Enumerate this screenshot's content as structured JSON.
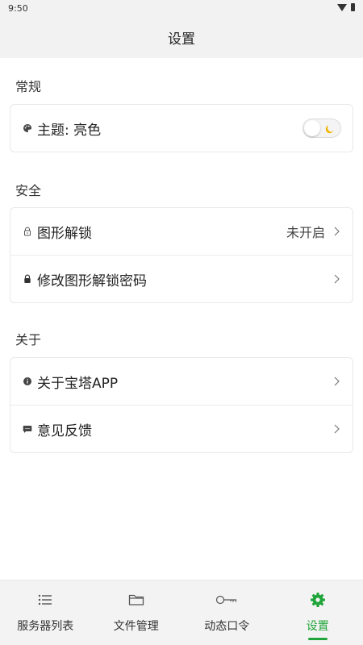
{
  "status_bar": {
    "time": "9:50"
  },
  "app_bar": {
    "title": "设置"
  },
  "sections": {
    "general": {
      "title": "常规",
      "theme": {
        "label": "主题: 亮色",
        "icon": "palette-icon",
        "toggle_on": false,
        "toggle_icon": "moon-icon"
      }
    },
    "security": {
      "title": "安全",
      "pattern_lock": {
        "label": "图形解锁",
        "value": "未开启",
        "icon": "lock-outline-icon"
      },
      "change_pattern": {
        "label": "修改图形解锁密码",
        "icon": "lock-filled-icon"
      }
    },
    "about": {
      "title": "关于",
      "about_app": {
        "label": "关于宝塔APP",
        "icon": "info-icon"
      },
      "feedback": {
        "label": "意见反馈",
        "icon": "chat-icon"
      }
    }
  },
  "tabs": [
    {
      "label": "服务器列表",
      "icon": "list-icon",
      "active": false
    },
    {
      "label": "文件管理",
      "icon": "folder-icon",
      "active": false
    },
    {
      "label": "动态口令",
      "icon": "key-icon",
      "active": false
    },
    {
      "label": "设置",
      "icon": "gear-icon",
      "active": true
    }
  ],
  "colors": {
    "accent": "#20a53a",
    "header_bg": "#f2f2f2",
    "tabbar_bg": "#f3f3f3"
  }
}
